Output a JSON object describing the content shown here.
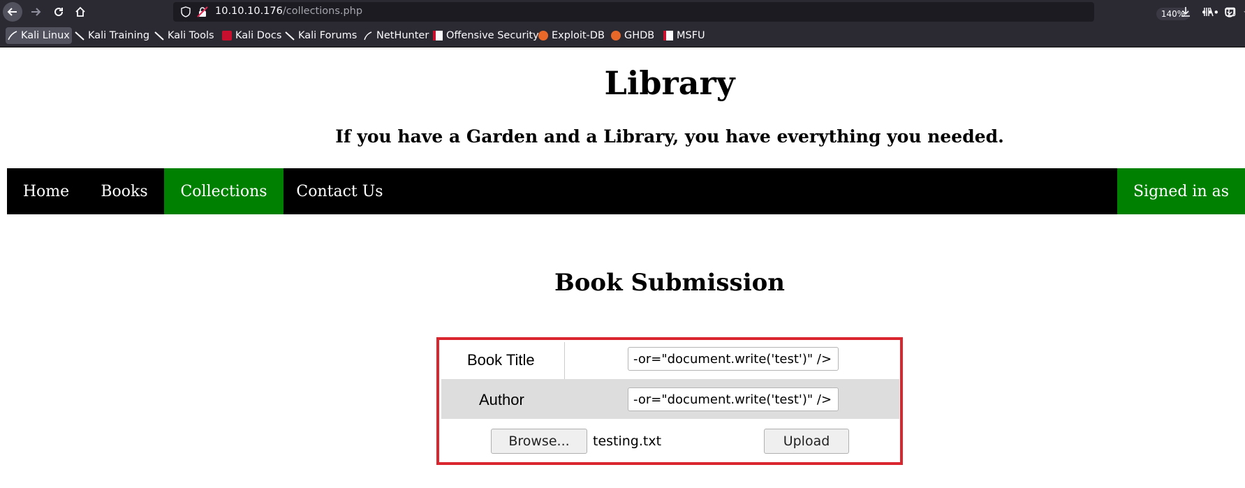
{
  "browser": {
    "url_host": "10.10.10.176",
    "url_path": "/collections.php",
    "zoom": "140%",
    "bookmarks": [
      {
        "label": "Kali Linux"
      },
      {
        "label": "Kali Training"
      },
      {
        "label": "Kali Tools"
      },
      {
        "label": "Kali Docs"
      },
      {
        "label": "Kali Forums"
      },
      {
        "label": "NetHunter"
      },
      {
        "label": "Offensive Security"
      },
      {
        "label": "Exploit-DB"
      },
      {
        "label": "GHDB"
      },
      {
        "label": "MSFU"
      }
    ]
  },
  "header": {
    "title": "Library",
    "subtitle": "If you have a Garden and a Library, you have everything you needed."
  },
  "nav": {
    "items": [
      {
        "label": "Home"
      },
      {
        "label": "Books"
      },
      {
        "label": "Collections"
      },
      {
        "label": "Contact Us"
      }
    ],
    "signed_in": "Signed in as"
  },
  "form": {
    "title": "Book Submission",
    "book_title_label": "Book Title",
    "book_title_value": "-or=\"document.write('test')\" />",
    "author_label": "Author",
    "author_value": "-or=\"document.write('test')\" />",
    "browse_label": "Browse...",
    "file_name": "testing.txt",
    "upload_label": "Upload"
  },
  "colors": {
    "nav_active": "#008000",
    "highlight_frame": "#d9262f"
  }
}
